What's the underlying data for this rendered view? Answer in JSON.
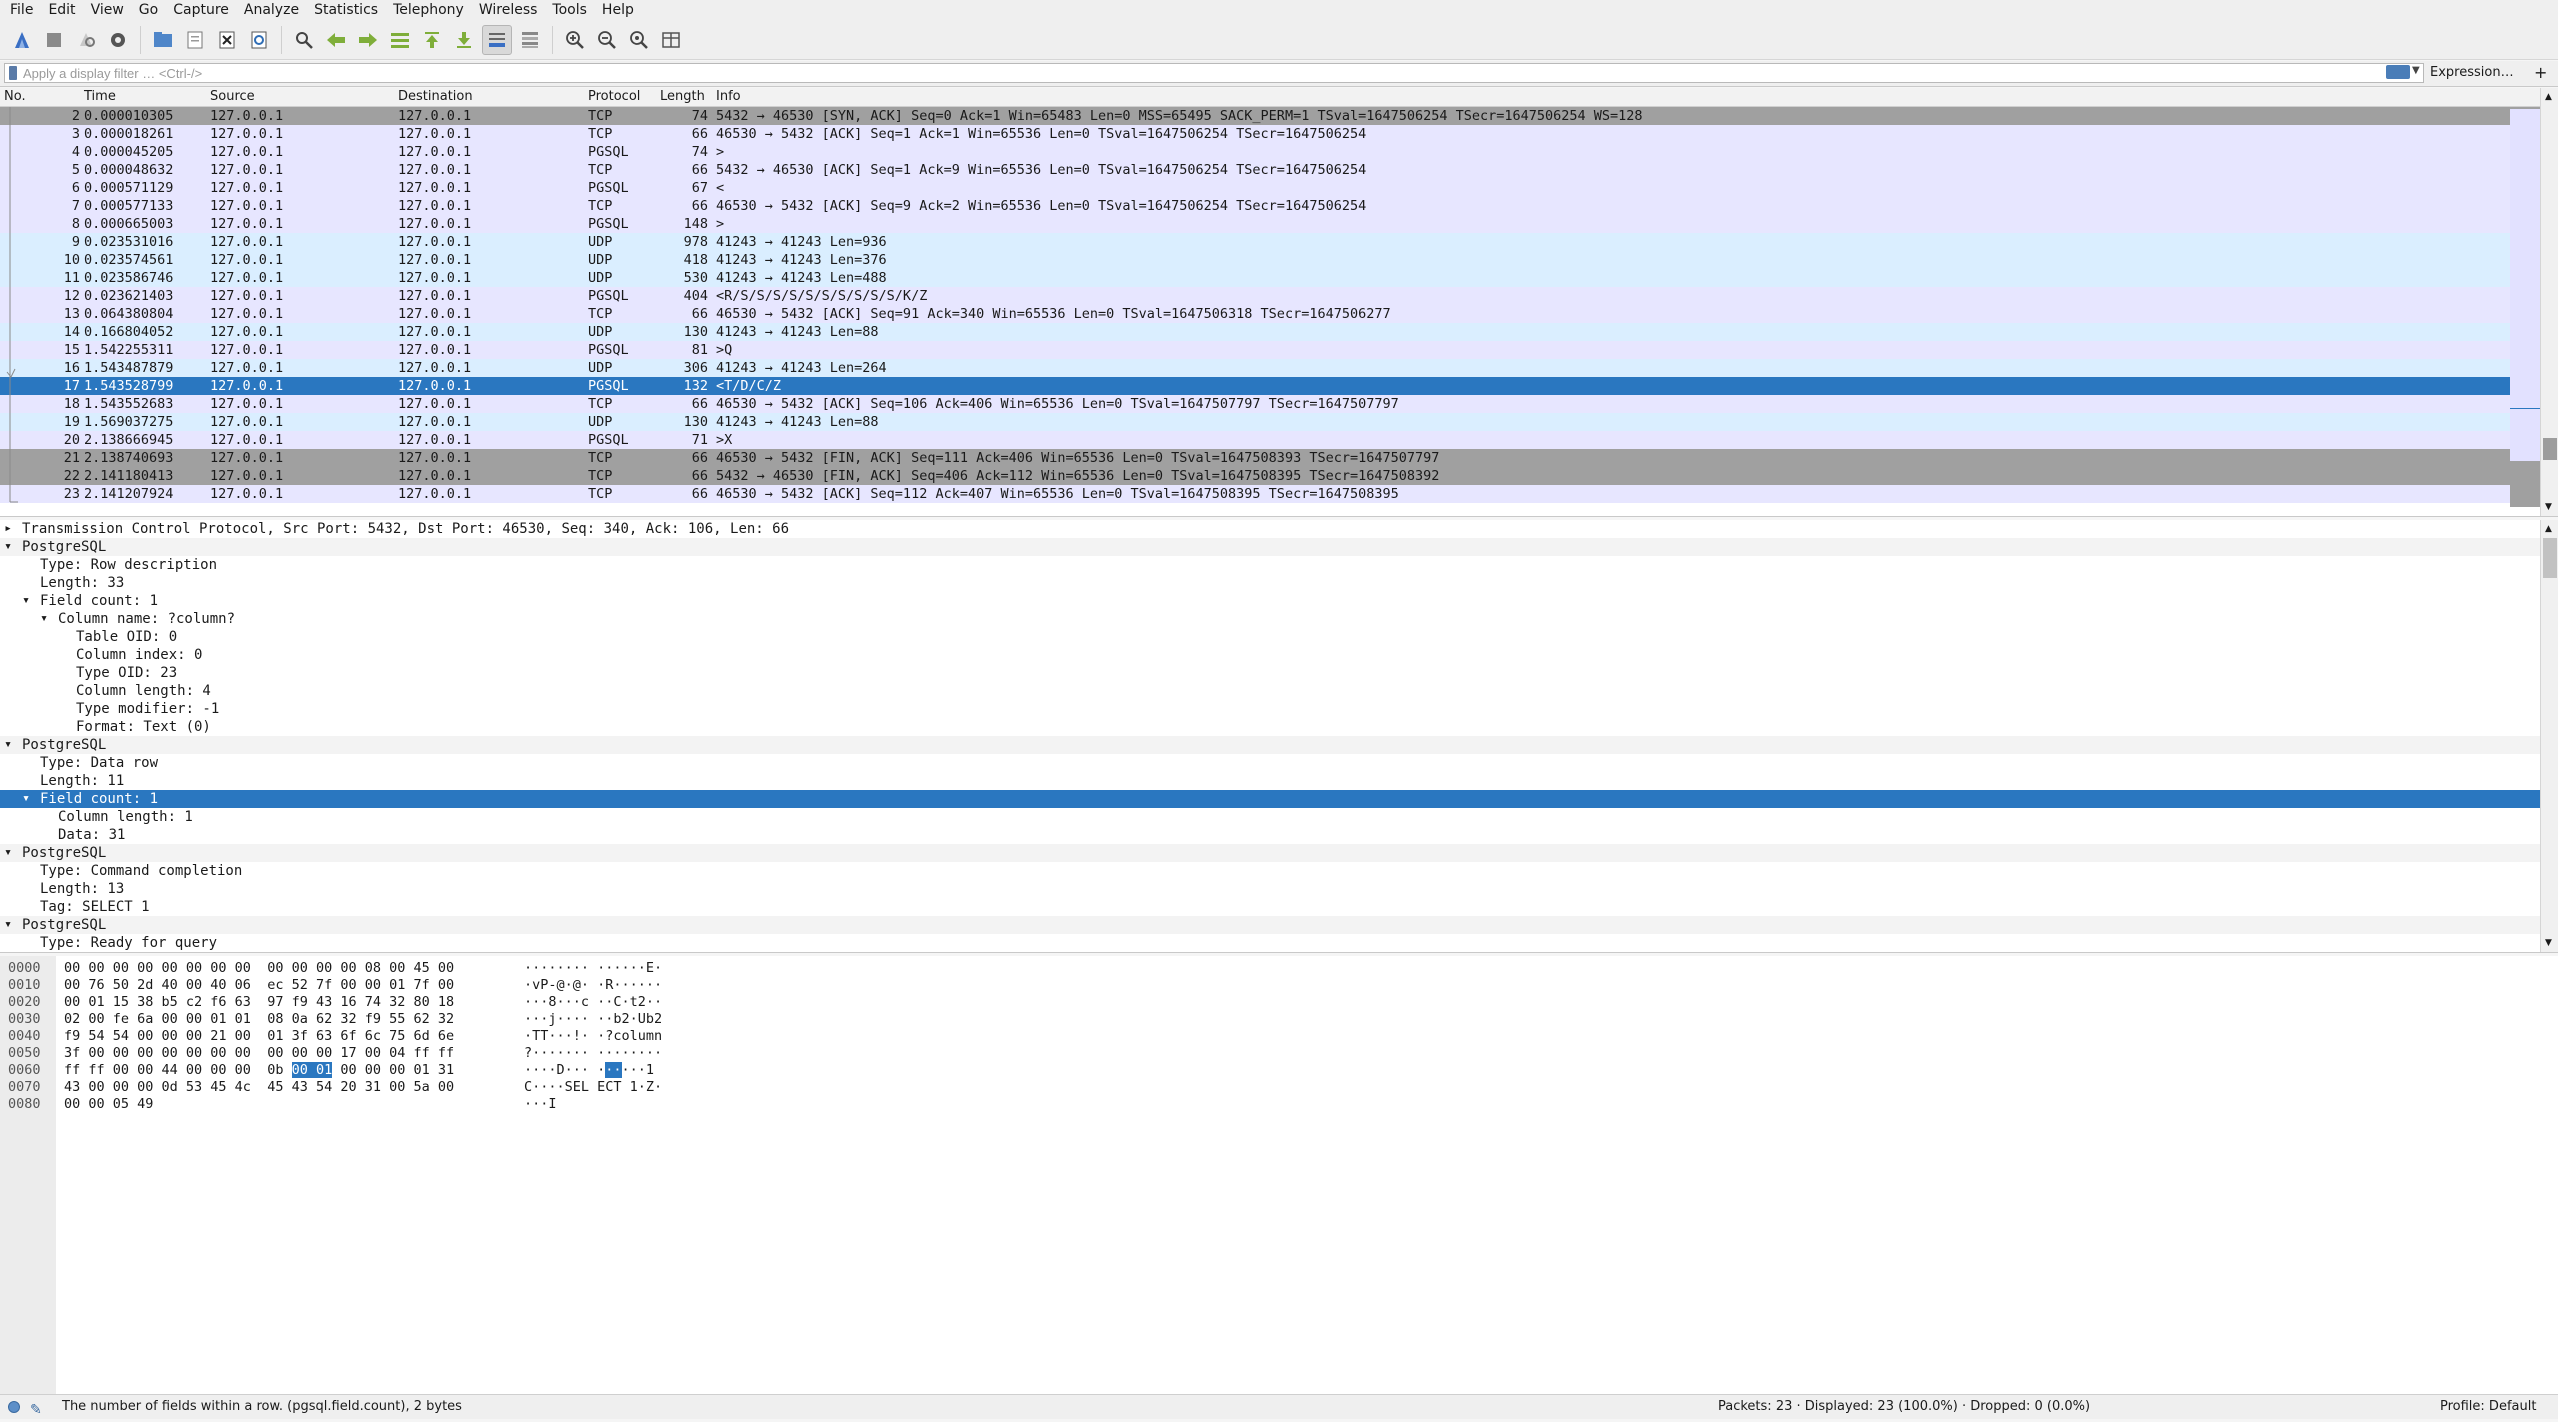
{
  "menu": [
    "File",
    "Edit",
    "View",
    "Go",
    "Capture",
    "Analyze",
    "Statistics",
    "Telephony",
    "Wireless",
    "Tools",
    "Help"
  ],
  "filter": {
    "placeholder": "Apply a display filter … <Ctrl-/>",
    "expression_label": "Expression…",
    "plus": "+"
  },
  "packet_list": {
    "columns": {
      "no": "No.",
      "time": "Time",
      "source": "Source",
      "destination": "Destination",
      "protocol": "Protocol",
      "length": "Length",
      "info": "Info"
    },
    "rows": [
      {
        "no": "2",
        "time": "0.000010305",
        "src": "127.0.0.1",
        "dst": "127.0.0.1",
        "proto": "TCP",
        "len": "74",
        "info": "5432 → 46530 [SYN, ACK] Seq=0 Ack=1 Win=65483 Len=0 MSS=65495 SACK_PERM=1 TSval=1647506254 TSecr=1647506254 WS=128",
        "style": "dark"
      },
      {
        "no": "3",
        "time": "0.000018261",
        "src": "127.0.0.1",
        "dst": "127.0.0.1",
        "proto": "TCP",
        "len": "66",
        "info": "46530 → 5432 [ACK] Seq=1 Ack=1 Win=65536 Len=0 TSval=1647506254 TSecr=1647506254",
        "style": "tcp"
      },
      {
        "no": "4",
        "time": "0.000045205",
        "src": "127.0.0.1",
        "dst": "127.0.0.1",
        "proto": "PGSQL",
        "len": "74",
        "info": ">",
        "style": "pgsql"
      },
      {
        "no": "5",
        "time": "0.000048632",
        "src": "127.0.0.1",
        "dst": "127.0.0.1",
        "proto": "TCP",
        "len": "66",
        "info": "5432 → 46530 [ACK] Seq=1 Ack=9 Win=65536 Len=0 TSval=1647506254 TSecr=1647506254",
        "style": "tcp"
      },
      {
        "no": "6",
        "time": "0.000571129",
        "src": "127.0.0.1",
        "dst": "127.0.0.1",
        "proto": "PGSQL",
        "len": "67",
        "info": "<",
        "style": "pgsql"
      },
      {
        "no": "7",
        "time": "0.000577133",
        "src": "127.0.0.1",
        "dst": "127.0.0.1",
        "proto": "TCP",
        "len": "66",
        "info": "46530 → 5432 [ACK] Seq=9 Ack=2 Win=65536 Len=0 TSval=1647506254 TSecr=1647506254",
        "style": "tcp"
      },
      {
        "no": "8",
        "time": "0.000665003",
        "src": "127.0.0.1",
        "dst": "127.0.0.1",
        "proto": "PGSQL",
        "len": "148",
        "info": ">",
        "style": "pgsql"
      },
      {
        "no": "9",
        "time": "0.023531016",
        "src": "127.0.0.1",
        "dst": "127.0.0.1",
        "proto": "UDP",
        "len": "978",
        "info": "41243 → 41243 Len=936",
        "style": "udp"
      },
      {
        "no": "10",
        "time": "0.023574561",
        "src": "127.0.0.1",
        "dst": "127.0.0.1",
        "proto": "UDP",
        "len": "418",
        "info": "41243 → 41243 Len=376",
        "style": "udp"
      },
      {
        "no": "11",
        "time": "0.023586746",
        "src": "127.0.0.1",
        "dst": "127.0.0.1",
        "proto": "UDP",
        "len": "530",
        "info": "41243 → 41243 Len=488",
        "style": "udp"
      },
      {
        "no": "12",
        "time": "0.023621403",
        "src": "127.0.0.1",
        "dst": "127.0.0.1",
        "proto": "PGSQL",
        "len": "404",
        "info": "<R/S/S/S/S/S/S/S/S/S/S/K/Z",
        "style": "pgsql"
      },
      {
        "no": "13",
        "time": "0.064380804",
        "src": "127.0.0.1",
        "dst": "127.0.0.1",
        "proto": "TCP",
        "len": "66",
        "info": "46530 → 5432 [ACK] Seq=91 Ack=340 Win=65536 Len=0 TSval=1647506318 TSecr=1647506277",
        "style": "tcp"
      },
      {
        "no": "14",
        "time": "0.166804052",
        "src": "127.0.0.1",
        "dst": "127.0.0.1",
        "proto": "UDP",
        "len": "130",
        "info": "41243 → 41243 Len=88",
        "style": "udp"
      },
      {
        "no": "15",
        "time": "1.542255311",
        "src": "127.0.0.1",
        "dst": "127.0.0.1",
        "proto": "PGSQL",
        "len": "81",
        "info": ">Q",
        "style": "pgsql"
      },
      {
        "no": "16",
        "time": "1.543487879",
        "src": "127.0.0.1",
        "dst": "127.0.0.1",
        "proto": "UDP",
        "len": "306",
        "info": "41243 → 41243 Len=264",
        "style": "udp"
      },
      {
        "no": "17",
        "time": "1.543528799",
        "src": "127.0.0.1",
        "dst": "127.0.0.1",
        "proto": "PGSQL",
        "len": "132",
        "info": "<T/D/C/Z",
        "style": "selected"
      },
      {
        "no": "18",
        "time": "1.543552683",
        "src": "127.0.0.1",
        "dst": "127.0.0.1",
        "proto": "TCP",
        "len": "66",
        "info": "46530 → 5432 [ACK] Seq=106 Ack=406 Win=65536 Len=0 TSval=1647507797 TSecr=1647507797",
        "style": "tcp"
      },
      {
        "no": "19",
        "time": "1.569037275",
        "src": "127.0.0.1",
        "dst": "127.0.0.1",
        "proto": "UDP",
        "len": "130",
        "info": "41243 → 41243 Len=88",
        "style": "udp"
      },
      {
        "no": "20",
        "time": "2.138666945",
        "src": "127.0.0.1",
        "dst": "127.0.0.1",
        "proto": "PGSQL",
        "len": "71",
        "info": ">X",
        "style": "pgsql"
      },
      {
        "no": "21",
        "time": "2.138740693",
        "src": "127.0.0.1",
        "dst": "127.0.0.1",
        "proto": "TCP",
        "len": "66",
        "info": "46530 → 5432 [FIN, ACK] Seq=111 Ack=406 Win=65536 Len=0 TSval=1647508393 TSecr=1647507797",
        "style": "dark"
      },
      {
        "no": "22",
        "time": "2.141180413",
        "src": "127.0.0.1",
        "dst": "127.0.0.1",
        "proto": "TCP",
        "len": "66",
        "info": "5432 → 46530 [FIN, ACK] Seq=406 Ack=112 Win=65536 Len=0 TSval=1647508395 TSecr=1647508392",
        "style": "dark"
      },
      {
        "no": "23",
        "time": "2.141207924",
        "src": "127.0.0.1",
        "dst": "127.0.0.1",
        "proto": "TCP",
        "len": "66",
        "info": "46530 → 5432 [ACK] Seq=112 Ack=407 Win=65536 Len=0 TSval=1647508395 TSecr=1647508395",
        "style": "tcp"
      }
    ]
  },
  "details": [
    {
      "level": 0,
      "arrow": "collapsed",
      "text": "Transmission Control Protocol, Src Port: 5432, Dst Port: 46530, Seq: 340, Ack: 106, Len: 66"
    },
    {
      "level": 0,
      "arrow": "expanded",
      "text": "PostgreSQL",
      "alt": true
    },
    {
      "level": 1,
      "arrow": "",
      "text": "Type: Row description"
    },
    {
      "level": 1,
      "arrow": "",
      "text": "Length: 33"
    },
    {
      "level": 1,
      "arrow": "expanded",
      "text": "Field count: 1"
    },
    {
      "level": 2,
      "arrow": "expanded",
      "text": "Column name: ?column?"
    },
    {
      "level": 3,
      "arrow": "",
      "text": "Table OID: 0"
    },
    {
      "level": 3,
      "arrow": "",
      "text": "Column index: 0"
    },
    {
      "level": 3,
      "arrow": "",
      "text": "Type OID: 23"
    },
    {
      "level": 3,
      "arrow": "",
      "text": "Column length: 4"
    },
    {
      "level": 3,
      "arrow": "",
      "text": "Type modifier: -1"
    },
    {
      "level": 3,
      "arrow": "",
      "text": "Format: Text (0)"
    },
    {
      "level": 0,
      "arrow": "expanded",
      "text": "PostgreSQL",
      "alt": true
    },
    {
      "level": 1,
      "arrow": "",
      "text": "Type: Data row"
    },
    {
      "level": 1,
      "arrow": "",
      "text": "Length: 11"
    },
    {
      "level": 1,
      "arrow": "expanded",
      "text": "Field count: 1",
      "selected": true
    },
    {
      "level": 2,
      "arrow": "",
      "text": "Column length: 1"
    },
    {
      "level": 2,
      "arrow": "",
      "text": "Data: 31"
    },
    {
      "level": 0,
      "arrow": "expanded",
      "text": "PostgreSQL",
      "alt": true
    },
    {
      "level": 1,
      "arrow": "",
      "text": "Type: Command completion"
    },
    {
      "level": 1,
      "arrow": "",
      "text": "Length: 13"
    },
    {
      "level": 1,
      "arrow": "",
      "text": "Tag: SELECT 1"
    },
    {
      "level": 0,
      "arrow": "expanded",
      "text": "PostgreSQL",
      "alt": true
    },
    {
      "level": 1,
      "arrow": "",
      "text": "Type: Ready for query"
    }
  ],
  "bytes": [
    {
      "off": "0000",
      "hex": "00 00 00 00 00 00 00 00  00 00 00 00 08 00 45 00",
      "ascii": "········ ······E·"
    },
    {
      "off": "0010",
      "hex": "00 76 50 2d 40 00 40 06  ec 52 7f 00 00 01 7f 00",
      "ascii": "·vP-@·@· ·R······"
    },
    {
      "off": "0020",
      "hex": "00 01 15 38 b5 c2 f6 63  97 f9 43 16 74 32 80 18",
      "ascii": "···8···c ··C·t2··"
    },
    {
      "off": "0030",
      "hex": "02 00 fe 6a 00 00 01 01  08 0a 62 32 f9 55 62 32",
      "ascii": "···j···· ··b2·Ub2"
    },
    {
      "off": "0040",
      "hex": "f9 54 54 00 00 00 21 00  01 3f 63 6f 6c 75 6d 6e",
      "ascii": "·TT···!· ·?column"
    },
    {
      "off": "0050",
      "hex": "3f 00 00 00 00 00 00 00  00 00 00 17 00 04 ff ff",
      "ascii": "?······· ········"
    },
    {
      "off": "0060",
      "hex_pre": "ff ff 00 00 44 00 00 00  0b ",
      "hex_hl": "00 01",
      "hex_post": " 00 00 00 01 31",
      "ascii_pre": "····D··· ·",
      "ascii_hl": "··",
      "ascii_post": "···1"
    },
    {
      "off": "0070",
      "hex": "43 00 00 00 0d 53 45 4c  45 43 54 20 31 00 5a 00",
      "ascii": "C····SEL ECT 1·Z·"
    },
    {
      "off": "0080",
      "hex": "00 00 05 49",
      "ascii": "···I"
    }
  ],
  "status": {
    "message": "The number of fields within a row. (pgsql.field.count), 2 bytes",
    "packets": "Packets: 23 · Displayed: 23 (100.0%) · Dropped: 0 (0.0%)",
    "profile": "Profile: Default"
  },
  "colors": {
    "accent": "#2a77c0",
    "tcp_row": "#e7e6ff",
    "udp_row": "#daeeff",
    "dark_row": "#a0a0a0"
  }
}
